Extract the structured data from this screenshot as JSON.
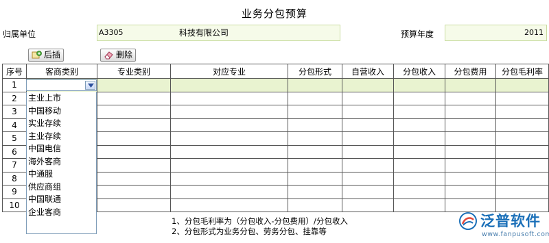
{
  "window": {
    "title": "业务分包预算"
  },
  "header": {
    "unit_label": "归属单位",
    "unit_code": "A3305",
    "unit_name": "科技有限公司",
    "year_label": "预算年度",
    "year_value": "2011"
  },
  "toolbar": {
    "insert_label": "后插",
    "delete_label": "删除"
  },
  "table": {
    "columns": [
      "序号",
      "客商类别",
      "专业类别",
      "对应专业",
      "分包形式",
      "自营收入",
      "分包收入",
      "分包费用",
      "分包毛利率"
    ],
    "rows": [
      "1",
      "2",
      "3",
      "4",
      "5",
      "6",
      "7",
      "8",
      "9",
      "10"
    ]
  },
  "dropdown": {
    "selected": "",
    "options": [
      "主业上市",
      "中国移动",
      "实业存续",
      "主业存续",
      "中国电信",
      "海外客商",
      "中通服",
      "供应商组",
      "中国联通",
      "企业客商"
    ]
  },
  "notes": [
    "1、分包毛利率为（分包收入-分包费用）/分包收入",
    "2、分包形式为业务分包、劳务分包、挂靠等"
  ],
  "brand": {
    "name": "泛普软件",
    "url": "www.fanpusoft.com"
  },
  "colors": {
    "field_bg": "#f6fbe9",
    "selected_row": "#e9f3d0",
    "brand_blue": "#1a6fb8"
  }
}
